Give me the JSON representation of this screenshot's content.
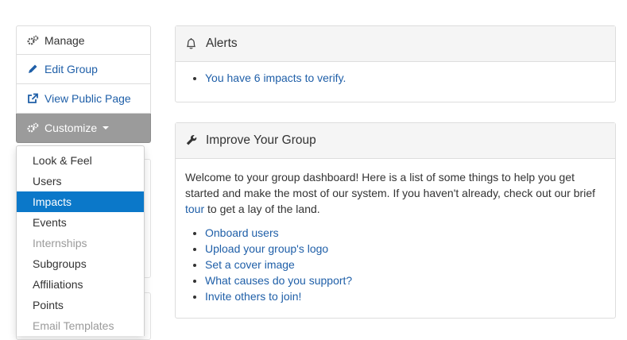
{
  "sidebar": {
    "items": [
      {
        "label": "Manage",
        "icon": "gears-icon"
      },
      {
        "label": "Edit Group",
        "icon": "pencil-icon"
      },
      {
        "label": "View Public Page",
        "icon": "external-link-icon"
      },
      {
        "label": "Customize",
        "icon": "gears-icon"
      }
    ]
  },
  "dropdown": {
    "items": [
      {
        "label": "Look & Feel"
      },
      {
        "label": "Users"
      },
      {
        "label": "Impacts"
      },
      {
        "label": "Events"
      },
      {
        "label": "Internships"
      },
      {
        "label": "Subgroups"
      },
      {
        "label": "Affiliations"
      },
      {
        "label": "Points"
      },
      {
        "label": "Email Templates"
      }
    ],
    "selected": "Impacts",
    "disabled": [
      "Internships",
      "Email Templates"
    ]
  },
  "alerts": {
    "title": "Alerts",
    "items": [
      "You have 6 impacts to verify."
    ]
  },
  "improve": {
    "title": "Improve Your Group",
    "intro_before": "Welcome to your group dashboard! Here is a list of some things to help you get started and make the most of our system. If you haven't already, check out our brief ",
    "intro_link": "tour",
    "intro_after": " to get a lay of the land.",
    "items": [
      "Onboard users",
      "Upload your group's logo",
      "Set a cover image",
      "What causes do you support?",
      "Invite others to join!"
    ]
  },
  "colors": {
    "link": "#1f5fa8",
    "selected": "#0b78c9",
    "customize_bg": "#9b9b9b"
  }
}
